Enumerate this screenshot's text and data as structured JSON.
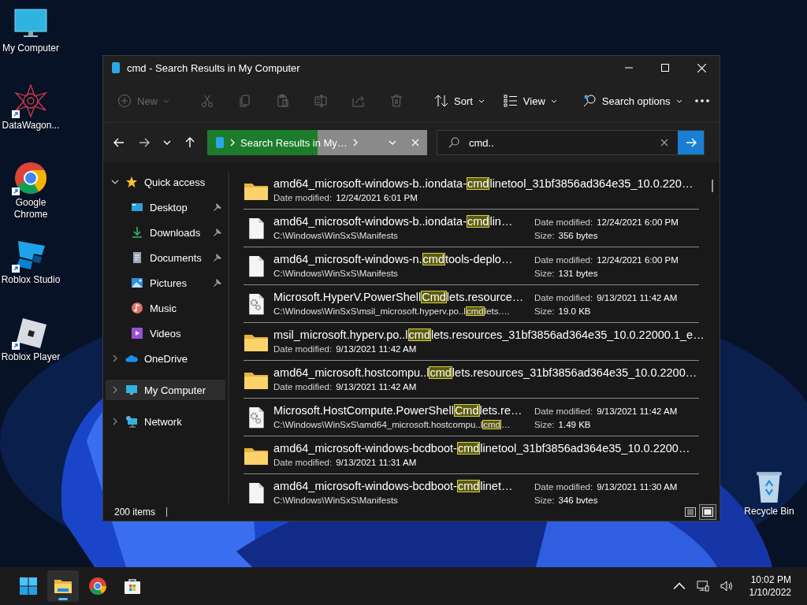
{
  "desktop_icons": [
    {
      "label": "My Computer",
      "kind": "computer",
      "shortcut": false
    },
    {
      "label": "DataWagon...",
      "kind": "datawagon",
      "shortcut": true
    },
    {
      "label": "Google Chrome",
      "kind": "chrome",
      "shortcut": true
    },
    {
      "label": "Roblox Studio",
      "kind": "studio",
      "shortcut": true
    },
    {
      "label": "Roblox Player",
      "kind": "player",
      "shortcut": true
    }
  ],
  "recycle_bin": {
    "label": "Recycle Bin"
  },
  "window": {
    "title": "cmd - Search Results in My Computer"
  },
  "toolbar": {
    "new": {
      "label": "New",
      "disabled": true
    },
    "actions": [
      {
        "disabled": true
      },
      {
        "disabled": true
      },
      {
        "disabled": true
      },
      {
        "disabled": true
      },
      {
        "disabled": true
      },
      {
        "disabled": true
      }
    ],
    "sort": {
      "label": "Sort",
      "disabled": false
    },
    "view": {
      "label": "View",
      "disabled": false
    },
    "search_options": {
      "label": "Search options",
      "disabled": false
    }
  },
  "address_bar": {
    "text": "Search Results in My…",
    "level": 0.5
  },
  "search": {
    "value": "cmd.."
  },
  "sidebar": {
    "items": [
      {
        "label": "Quick access",
        "kind": "star",
        "expanded": true,
        "selected": false,
        "children": [
          {
            "label": "Desktop",
            "kind": "desktop",
            "pinned": true,
            "selected": false
          },
          {
            "label": "Downloads",
            "kind": "downloads",
            "pinned": true,
            "selected": false
          },
          {
            "label": "Documents",
            "kind": "documents",
            "pinned": true,
            "selected": false
          },
          {
            "label": "Pictures",
            "kind": "pictures",
            "pinned": true,
            "selected": false
          },
          {
            "label": "Music",
            "kind": "music",
            "pinned": false,
            "selected": false
          },
          {
            "label": "Videos",
            "kind": "videos",
            "pinned": false,
            "selected": false
          }
        ]
      },
      {
        "label": "OneDrive",
        "kind": "cloud",
        "expanded": false,
        "selected": false
      },
      {
        "label": "My Computer",
        "kind": "computer",
        "expanded": false,
        "selected": true
      },
      {
        "label": "Network",
        "kind": "network",
        "expanded": false,
        "selected": false
      }
    ]
  },
  "results": [
    {
      "kind": "folder",
      "name": [
        {
          "text": "amd64_microsoft-windows-b..iondata-",
          "highlight": false
        },
        {
          "text": "cmd",
          "highlight": true
        },
        {
          "text": "linetool_31bf3856ad364e35_10.0.220…",
          "highlight": false
        }
      ],
      "date_label": "Date modified:",
      "date": "12/24/2021 6:01 PM"
    },
    {
      "kind": "file",
      "name": [
        {
          "text": "amd64_microsoft-windows-b..iondata-",
          "highlight": false
        },
        {
          "text": "cmd",
          "highlight": true
        },
        {
          "text": "lin…",
          "highlight": false
        }
      ],
      "path": [
        {
          "text": "C:\\Windows\\WinSxS\\Manifests",
          "highlight": false
        }
      ],
      "date_label": "Date modified:",
      "date": "12/24/2021 6:00 PM",
      "size_label": "Size:",
      "size": "356 bytes"
    },
    {
      "kind": "file",
      "name": [
        {
          "text": "amd64_microsoft-windows-n.",
          "highlight": false
        },
        {
          "text": "cmd",
          "highlight": true
        },
        {
          "text": "tools-deplo…",
          "highlight": false
        }
      ],
      "path": [
        {
          "text": "C:\\Windows\\WinSxS\\Manifests",
          "highlight": false
        }
      ],
      "date_label": "Date modified:",
      "date": "12/24/2021 6:00 PM",
      "size_label": "Size:",
      "size": "131 bytes"
    },
    {
      "kind": "settings",
      "name": [
        {
          "text": "Microsoft.HyperV.PowerShell",
          "highlight": false
        },
        {
          "text": "Cmd",
          "highlight": true
        },
        {
          "text": "lets.resource…",
          "highlight": false
        }
      ],
      "path": [
        {
          "text": "C:\\Windows\\WinSxS\\msil_microsoft.hyperv.po..l",
          "highlight": false
        },
        {
          "text": "cmd",
          "highlight": true
        },
        {
          "text": "lets.…",
          "highlight": false
        }
      ],
      "date_label": "Date modified:",
      "date": "9/13/2021 11:42 AM",
      "size_label": "Size:",
      "size": "19.0 KB"
    },
    {
      "kind": "folder",
      "name": [
        {
          "text": "msil_microsoft.hyperv.po..l",
          "highlight": false
        },
        {
          "text": "cmd",
          "highlight": true
        },
        {
          "text": "lets.resources_31bf3856ad364e35_10.0.22000.1_e…",
          "highlight": false
        }
      ],
      "date_label": "Date modified:",
      "date": "9/13/2021 11:42 AM"
    },
    {
      "kind": "folder",
      "name": [
        {
          "text": "amd64_microsoft.hostcompu..l",
          "highlight": false
        },
        {
          "text": "cmd",
          "highlight": true
        },
        {
          "text": "lets.resources_31bf3856ad364e35_10.0.2200…",
          "highlight": false
        }
      ],
      "date_label": "Date modified:",
      "date": "9/13/2021 11:42 AM"
    },
    {
      "kind": "settings",
      "name": [
        {
          "text": "Microsoft.HostCompute.PowerShell",
          "highlight": false
        },
        {
          "text": "Cmd",
          "highlight": true
        },
        {
          "text": "lets.re…",
          "highlight": false
        }
      ],
      "path": [
        {
          "text": "C:\\Windows\\WinSxS\\amd64_microsoft.hostcompu..l",
          "highlight": false
        },
        {
          "text": "cmd",
          "highlight": true
        },
        {
          "text": "…",
          "highlight": false
        }
      ],
      "date_label": "Date modified:",
      "date": "9/13/2021 11:42 AM",
      "size_label": "Size:",
      "size": "1.49 KB"
    },
    {
      "kind": "folder",
      "name": [
        {
          "text": "amd64_microsoft-windows-bcdboot-",
          "highlight": false
        },
        {
          "text": "cmd",
          "highlight": true
        },
        {
          "text": "linetool_31bf3856ad364e35_10.0.2200…",
          "highlight": false
        }
      ],
      "date_label": "Date modified:",
      "date": "9/13/2021 11:31 AM"
    },
    {
      "kind": "file",
      "name": [
        {
          "text": "amd64_microsoft-windows-bcdboot-",
          "highlight": false
        },
        {
          "text": "cmd",
          "highlight": true
        },
        {
          "text": "linet…",
          "highlight": false
        }
      ],
      "path": [
        {
          "text": "C:\\Windows\\WinSxS\\Manifests",
          "highlight": false
        }
      ],
      "date_label": "Date modified:",
      "date": "9/13/2021 11:30 AM",
      "size_label": "Size:",
      "size": "346 bvtes"
    }
  ],
  "status_bar": {
    "count": "200 items",
    "views": [
      {
        "selected": false
      },
      {
        "selected": true
      }
    ]
  },
  "taskbar": {
    "apps": [
      {
        "kind": "start",
        "active": false
      },
      {
        "kind": "explorer",
        "active": true
      },
      {
        "kind": "chrome",
        "active": false
      },
      {
        "kind": "store",
        "active": false
      }
    ],
    "time": "10:02 PM",
    "date": "1/10/2022"
  }
}
